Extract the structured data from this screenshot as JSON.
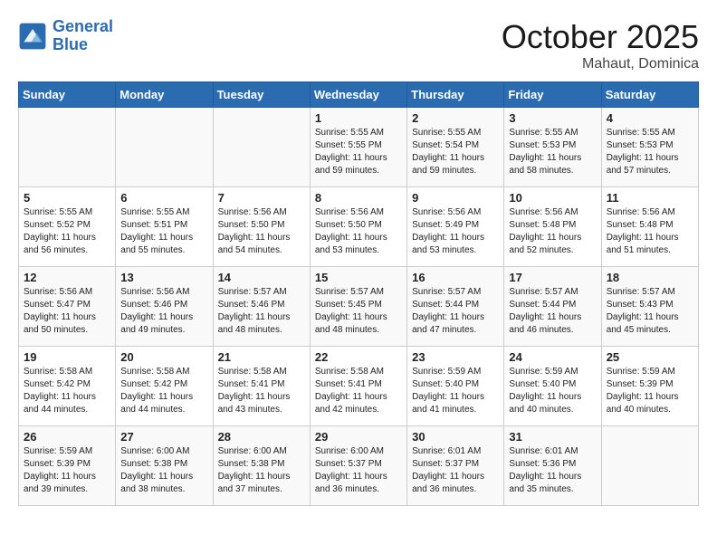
{
  "header": {
    "logo_line1": "General",
    "logo_line2": "Blue",
    "month": "October 2025",
    "location": "Mahaut, Dominica"
  },
  "weekdays": [
    "Sunday",
    "Monday",
    "Tuesday",
    "Wednesday",
    "Thursday",
    "Friday",
    "Saturday"
  ],
  "weeks": [
    [
      {
        "day": "",
        "info": ""
      },
      {
        "day": "",
        "info": ""
      },
      {
        "day": "",
        "info": ""
      },
      {
        "day": "1",
        "info": "Sunrise: 5:55 AM\nSunset: 5:55 PM\nDaylight: 11 hours\nand 59 minutes."
      },
      {
        "day": "2",
        "info": "Sunrise: 5:55 AM\nSunset: 5:54 PM\nDaylight: 11 hours\nand 59 minutes."
      },
      {
        "day": "3",
        "info": "Sunrise: 5:55 AM\nSunset: 5:53 PM\nDaylight: 11 hours\nand 58 minutes."
      },
      {
        "day": "4",
        "info": "Sunrise: 5:55 AM\nSunset: 5:53 PM\nDaylight: 11 hours\nand 57 minutes."
      }
    ],
    [
      {
        "day": "5",
        "info": "Sunrise: 5:55 AM\nSunset: 5:52 PM\nDaylight: 11 hours\nand 56 minutes."
      },
      {
        "day": "6",
        "info": "Sunrise: 5:55 AM\nSunset: 5:51 PM\nDaylight: 11 hours\nand 55 minutes."
      },
      {
        "day": "7",
        "info": "Sunrise: 5:56 AM\nSunset: 5:50 PM\nDaylight: 11 hours\nand 54 minutes."
      },
      {
        "day": "8",
        "info": "Sunrise: 5:56 AM\nSunset: 5:50 PM\nDaylight: 11 hours\nand 53 minutes."
      },
      {
        "day": "9",
        "info": "Sunrise: 5:56 AM\nSunset: 5:49 PM\nDaylight: 11 hours\nand 53 minutes."
      },
      {
        "day": "10",
        "info": "Sunrise: 5:56 AM\nSunset: 5:48 PM\nDaylight: 11 hours\nand 52 minutes."
      },
      {
        "day": "11",
        "info": "Sunrise: 5:56 AM\nSunset: 5:48 PM\nDaylight: 11 hours\nand 51 minutes."
      }
    ],
    [
      {
        "day": "12",
        "info": "Sunrise: 5:56 AM\nSunset: 5:47 PM\nDaylight: 11 hours\nand 50 minutes."
      },
      {
        "day": "13",
        "info": "Sunrise: 5:56 AM\nSunset: 5:46 PM\nDaylight: 11 hours\nand 49 minutes."
      },
      {
        "day": "14",
        "info": "Sunrise: 5:57 AM\nSunset: 5:46 PM\nDaylight: 11 hours\nand 48 minutes."
      },
      {
        "day": "15",
        "info": "Sunrise: 5:57 AM\nSunset: 5:45 PM\nDaylight: 11 hours\nand 48 minutes."
      },
      {
        "day": "16",
        "info": "Sunrise: 5:57 AM\nSunset: 5:44 PM\nDaylight: 11 hours\nand 47 minutes."
      },
      {
        "day": "17",
        "info": "Sunrise: 5:57 AM\nSunset: 5:44 PM\nDaylight: 11 hours\nand 46 minutes."
      },
      {
        "day": "18",
        "info": "Sunrise: 5:57 AM\nSunset: 5:43 PM\nDaylight: 11 hours\nand 45 minutes."
      }
    ],
    [
      {
        "day": "19",
        "info": "Sunrise: 5:58 AM\nSunset: 5:42 PM\nDaylight: 11 hours\nand 44 minutes."
      },
      {
        "day": "20",
        "info": "Sunrise: 5:58 AM\nSunset: 5:42 PM\nDaylight: 11 hours\nand 44 minutes."
      },
      {
        "day": "21",
        "info": "Sunrise: 5:58 AM\nSunset: 5:41 PM\nDaylight: 11 hours\nand 43 minutes."
      },
      {
        "day": "22",
        "info": "Sunrise: 5:58 AM\nSunset: 5:41 PM\nDaylight: 11 hours\nand 42 minutes."
      },
      {
        "day": "23",
        "info": "Sunrise: 5:59 AM\nSunset: 5:40 PM\nDaylight: 11 hours\nand 41 minutes."
      },
      {
        "day": "24",
        "info": "Sunrise: 5:59 AM\nSunset: 5:40 PM\nDaylight: 11 hours\nand 40 minutes."
      },
      {
        "day": "25",
        "info": "Sunrise: 5:59 AM\nSunset: 5:39 PM\nDaylight: 11 hours\nand 40 minutes."
      }
    ],
    [
      {
        "day": "26",
        "info": "Sunrise: 5:59 AM\nSunset: 5:39 PM\nDaylight: 11 hours\nand 39 minutes."
      },
      {
        "day": "27",
        "info": "Sunrise: 6:00 AM\nSunset: 5:38 PM\nDaylight: 11 hours\nand 38 minutes."
      },
      {
        "day": "28",
        "info": "Sunrise: 6:00 AM\nSunset: 5:38 PM\nDaylight: 11 hours\nand 37 minutes."
      },
      {
        "day": "29",
        "info": "Sunrise: 6:00 AM\nSunset: 5:37 PM\nDaylight: 11 hours\nand 36 minutes."
      },
      {
        "day": "30",
        "info": "Sunrise: 6:01 AM\nSunset: 5:37 PM\nDaylight: 11 hours\nand 36 minutes."
      },
      {
        "day": "31",
        "info": "Sunrise: 6:01 AM\nSunset: 5:36 PM\nDaylight: 11 hours\nand 35 minutes."
      },
      {
        "day": "",
        "info": ""
      }
    ]
  ]
}
